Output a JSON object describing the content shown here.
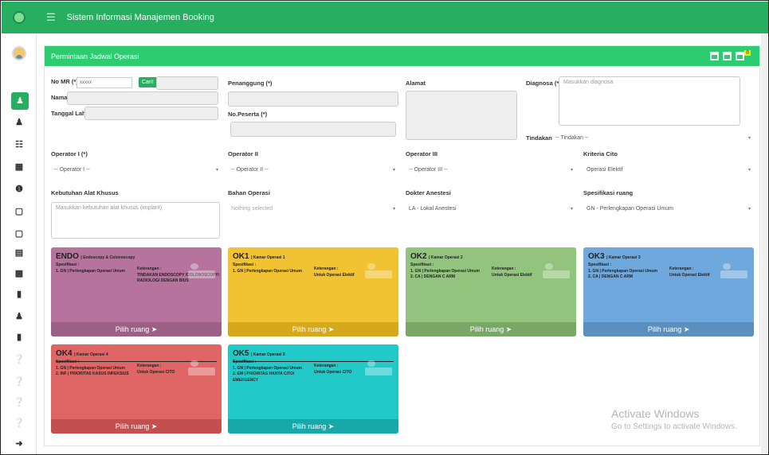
{
  "app": {
    "title": "Sistem Informasi Manajemen Booking"
  },
  "colors": {
    "brand": "#27ae60",
    "panel_header": "#2ecc71"
  },
  "sidebar": {
    "icons": [
      "user-plus-icon",
      "user-check-icon",
      "sitemap-icon",
      "calendar-icon",
      "info-icon",
      "monitor-icon",
      "monitor-icon",
      "bed-icon",
      "printer-icon",
      "document-icon",
      "person-icon",
      "clipboard-icon",
      "help-icon",
      "help-icon",
      "help-icon",
      "help-icon",
      "logout-icon"
    ]
  },
  "panel": {
    "title": "Permintaan Jadwal Operasi",
    "badge": "8"
  },
  "form": {
    "no_mr_label": "No MR (*)",
    "no_mr_value": "xxxxx",
    "cari_label": "Cari!",
    "nama_label": "Nama",
    "tanggal_lahir_label": "Tanggal Lahir",
    "penanggung_label": "Penanggung (*)",
    "no_peserta_label": "No.Peserta (*)",
    "alamat_label": "Alamat",
    "diagnosa_label": "Diagnosa (*)",
    "diagnosa_placeholder": "Masukkan diagnosa",
    "tindakan_label": "Tindakan",
    "tindakan_value": "-- Tindakan --",
    "operator1_label": "Operator I (*)",
    "operator1_value": "-- Operator I --",
    "operator2_label": "Operator II",
    "operator2_value": "-- Operator II --",
    "operator3_label": "Operator III",
    "operator3_value": "-- Operator III --",
    "kriteria_label": "Kriteria Cito",
    "kriteria_value": "Operasi Elektif",
    "alat_label": "Kebutuhan Alat Khusus",
    "alat_placeholder": "Masukkan kebutuhan alat khusus (implant)",
    "bahan_label": "Bahan Operasi",
    "bahan_value": "Nothing selected",
    "anestesi_label": "Dokter Anestesi",
    "anestesi_value": "LA - Lokal Anestesi",
    "spesifikasi_label": "Spesifikasi ruang",
    "spesifikasi_value": "GN - Perlengkapan Operasi Umum"
  },
  "rooms": [
    {
      "code": "ENDO",
      "name": "Endoscopy & Colonoscopy",
      "spec_label": "Spesifikasi :",
      "specs": [
        "1. GN | Perlengkapan Operasi Umum"
      ],
      "ket_label": "Keterangan :",
      "ket": "TINDAKAN ENDOSCOPY /COLONOSCOPY/ RADIOLOGI DENGAN BIUS",
      "action": "Pilih ruang",
      "color": "#b5739d",
      "foot_color": "#9c5f86"
    },
    {
      "code": "OK1",
      "name": "Kamar Operasi 1",
      "spec_label": "Spesifikasi :",
      "specs": [
        "1. GN | Perlengkapan Operasi Umum"
      ],
      "ket_label": "Keterangan :",
      "ket": "Untuk Operasi Elektif",
      "action": "Pilih ruang",
      "color": "#f1c232",
      "foot_color": "#d6a91c"
    },
    {
      "code": "OK2",
      "name": "Kamar Operasi 2",
      "spec_label": "Spesifikasi :",
      "specs": [
        "1. GN | Perlengkapan Operasi Umum",
        "2. CA | DENGAN C ARM"
      ],
      "ket_label": "Keterangan :",
      "ket": "Untuk Operasi Elektif",
      "action": "Pilih ruang",
      "color": "#93c47d",
      "foot_color": "#79a866"
    },
    {
      "code": "OK3",
      "name": "Kamar Operasi 3",
      "spec_label": "Spesifikasi :",
      "specs": [
        "1. GN | Perlengkapan Operasi Umum",
        "2. CA | DENGAN C ARM"
      ],
      "ket_label": "Keterangan :",
      "ket": "Untuk Operasi Elektif",
      "action": "Pilih ruang",
      "color": "#6fa8dc",
      "foot_color": "#5a8fc0"
    },
    {
      "code": "OK4",
      "name": "Kamar Operasi 4",
      "spec_label": "Spesifikasi :",
      "specs": [
        "1. GN | Perlengkapan Operasi Umum",
        "2. INF | PRIORITAS KASUS INFEKSIUS"
      ],
      "ket_label": "Keterangan :",
      "ket": "Untuk Operasi CITO",
      "action": "Pilih ruang",
      "color": "#e06666",
      "foot_color": "#c44f4f"
    },
    {
      "code": "OK5",
      "name": "Kamar Operasi 5",
      "spec_label": "Spesifikasi :",
      "specs": [
        "1. GN | Perlengkapan Operasi Umum",
        "2. EM | PRIORITAS HANYA CITO/ EMERGENCY"
      ],
      "ket_label": "Keterangan :",
      "ket": "Untuk Operasi CITO",
      "action": "Pilih ruang",
      "color": "#22c9c9",
      "foot_color": "#17a9a9"
    }
  ],
  "watermark": {
    "line1": "Activate Windows",
    "line2": "Go to Settings to activate Windows."
  }
}
